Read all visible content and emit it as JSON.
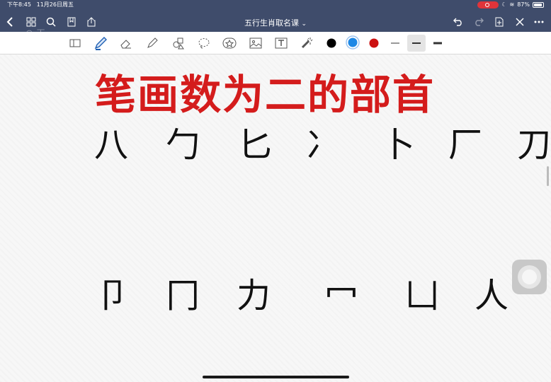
{
  "status_bar": {
    "time": "下午8:45",
    "date": "11月26日周五",
    "battery": "87%"
  },
  "header": {
    "title": "五行生肖取名课",
    "title_chevron": "⌄"
  },
  "colors": {
    "topbar": "#3f4c6b",
    "heading": "#d41c1c",
    "black": "#000000",
    "blue": "#1e88e5",
    "red": "#cc1111"
  },
  "canvas": {
    "heading": "笔画数为二的部首",
    "radicals_row1": [
      "八",
      "勹",
      "匕",
      "冫",
      "卜",
      "厂",
      "刀"
    ],
    "radicals_row2": [
      "卩",
      "冂",
      "力",
      "冖",
      "凵",
      "人"
    ]
  }
}
